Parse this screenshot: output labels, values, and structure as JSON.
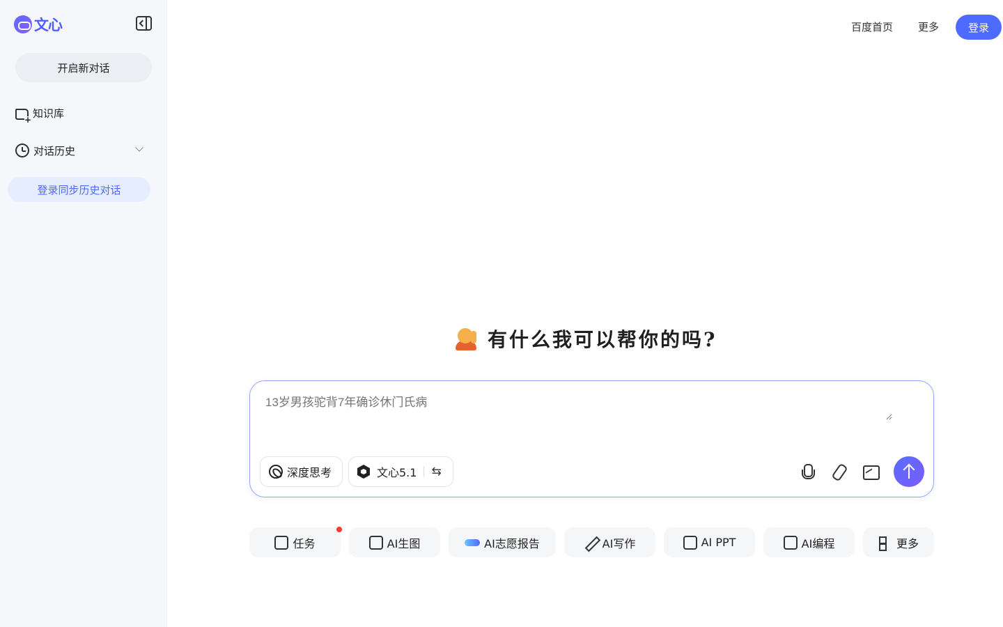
{
  "sidebar": {
    "logo_text": "文心",
    "new_chat_label": "开启新对话",
    "items": [
      {
        "label": "知识库",
        "icon": "folder-add-icon"
      },
      {
        "label": "对话历史",
        "icon": "clock-icon"
      }
    ],
    "login_sync_label": "登录同步历史对话"
  },
  "header": {
    "links": [
      "百度首页",
      "更多"
    ],
    "login_label": "登录"
  },
  "main": {
    "greeting": "有什么我可以帮你的吗?",
    "input": {
      "placeholder": "13岁男孩驼背7年确诊休门氏病"
    },
    "deep_think_label": "深度思考",
    "model_label": "文心5.1",
    "chips": [
      {
        "label": "任务",
        "icon": "task-icon",
        "has_badge": true
      },
      {
        "label": "AI生图",
        "icon": "image-gen-icon"
      },
      {
        "label": "AI志愿报告",
        "icon": "wave-icon"
      },
      {
        "label": "AI写作",
        "icon": "pen-icon"
      },
      {
        "label": "AI PPT",
        "icon": "ppt-icon"
      },
      {
        "label": "AI编程",
        "icon": "code-icon"
      },
      {
        "label": "更多",
        "icon": "grid-icon"
      }
    ]
  },
  "colors": {
    "accent": "#4d6bfe",
    "sidebar_bg": "#f6f7fb",
    "badge": "#ff3b30"
  }
}
